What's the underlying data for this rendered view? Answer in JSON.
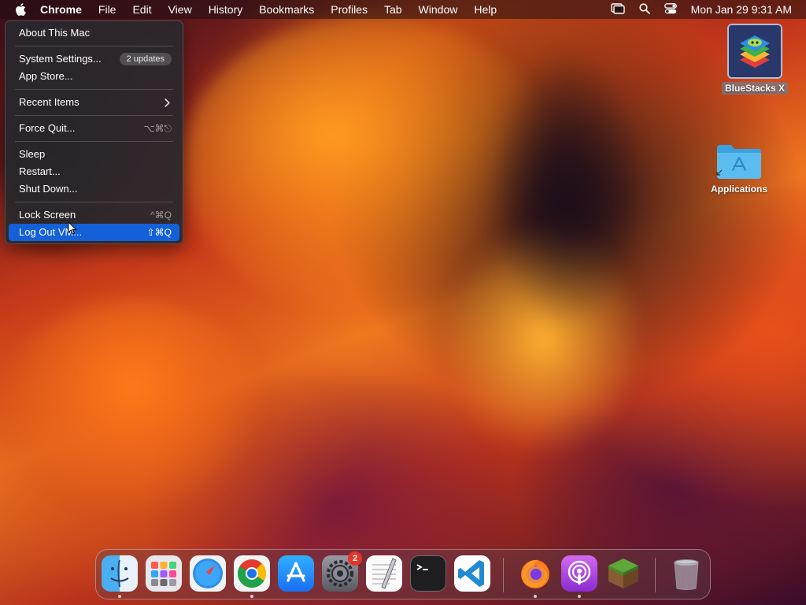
{
  "menubar": {
    "app_name": "Chrome",
    "menus": [
      "File",
      "Edit",
      "View",
      "History",
      "Bookmarks",
      "Profiles",
      "Tab",
      "Window",
      "Help"
    ],
    "clock": "Mon Jan 29  9:31 AM"
  },
  "apple_menu": {
    "about": "About This Mac",
    "system_settings": "System Settings...",
    "updates_badge": "2 updates",
    "app_store": "App Store...",
    "recent_items": "Recent Items",
    "force_quit": "Force Quit...",
    "force_quit_shortcut": "⌥⌘⎋",
    "sleep": "Sleep",
    "restart": "Restart...",
    "shut_down": "Shut Down...",
    "lock_screen": "Lock Screen",
    "lock_screen_shortcut": "^⌘Q",
    "log_out": "Log Out VM...",
    "log_out_shortcut": "⇧⌘Q"
  },
  "desktop": {
    "bluestacks_label": "BlueStacks X",
    "applications_label": "Applications"
  },
  "dock": {
    "apps": [
      "Finder",
      "Launchpad",
      "Safari",
      "Chrome",
      "App Store",
      "System Settings",
      "TextEdit",
      "Terminal",
      "Visual Studio Code",
      "Firefox",
      "Podcasts",
      "Minecraft",
      "Trash"
    ],
    "settings_badge": "2"
  }
}
